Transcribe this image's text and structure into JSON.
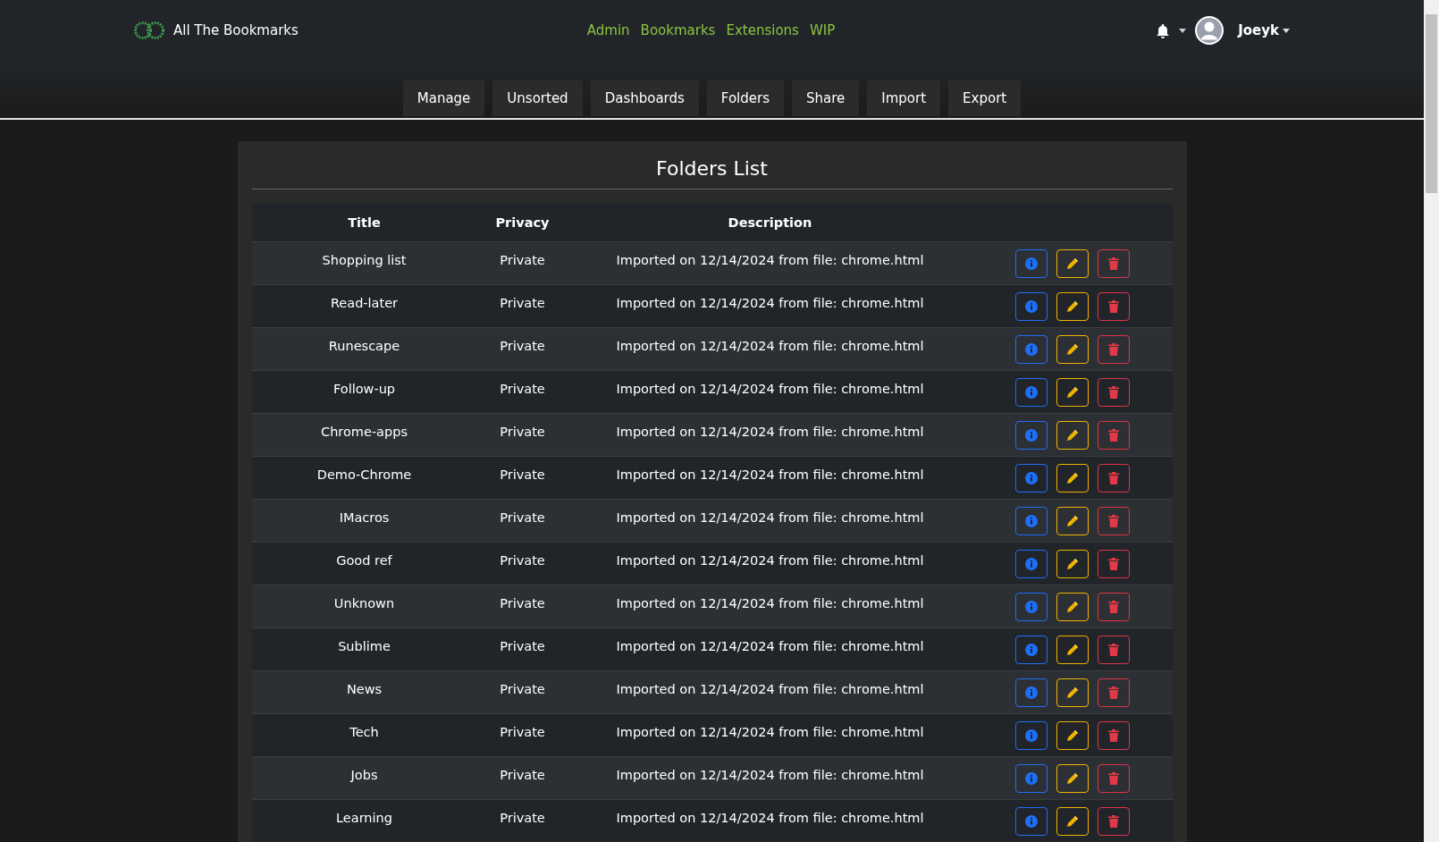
{
  "brand": {
    "name": "All The Bookmarks"
  },
  "nav_links": [
    "Admin",
    "Bookmarks",
    "Extensions",
    "WIP"
  ],
  "user": {
    "name": "Joeyk"
  },
  "tabs": [
    {
      "label": "Manage",
      "selected": false
    },
    {
      "label": "Unsorted",
      "selected": false
    },
    {
      "label": "Dashboards",
      "selected": false
    },
    {
      "label": "Folders",
      "selected": false
    },
    {
      "label": "Share",
      "selected": false
    },
    {
      "label": "Import",
      "selected": false
    },
    {
      "label": "Export",
      "selected": false
    }
  ],
  "panel": {
    "title": "Folders List"
  },
  "table": {
    "columns": [
      "Title",
      "Privacy",
      "Description"
    ],
    "rows": [
      {
        "title": "Shopping list",
        "privacy": "Private",
        "description": "Imported on 12/14/2024 from file: chrome.html"
      },
      {
        "title": "Read-later",
        "privacy": "Private",
        "description": "Imported on 12/14/2024 from file: chrome.html"
      },
      {
        "title": "Runescape",
        "privacy": "Private",
        "description": "Imported on 12/14/2024 from file: chrome.html"
      },
      {
        "title": "Follow-up",
        "privacy": "Private",
        "description": "Imported on 12/14/2024 from file: chrome.html"
      },
      {
        "title": "Chrome-apps",
        "privacy": "Private",
        "description": "Imported on 12/14/2024 from file: chrome.html"
      },
      {
        "title": "Demo-Chrome",
        "privacy": "Private",
        "description": "Imported on 12/14/2024 from file: chrome.html"
      },
      {
        "title": "IMacros",
        "privacy": "Private",
        "description": "Imported on 12/14/2024 from file: chrome.html"
      },
      {
        "title": "Good ref",
        "privacy": "Private",
        "description": "Imported on 12/14/2024 from file: chrome.html"
      },
      {
        "title": "Unknown",
        "privacy": "Private",
        "description": "Imported on 12/14/2024 from file: chrome.html"
      },
      {
        "title": "Sublime",
        "privacy": "Private",
        "description": "Imported on 12/14/2024 from file: chrome.html"
      },
      {
        "title": "News",
        "privacy": "Private",
        "description": "Imported on 12/14/2024 from file: chrome.html"
      },
      {
        "title": "Tech",
        "privacy": "Private",
        "description": "Imported on 12/14/2024 from file: chrome.html"
      },
      {
        "title": "Jobs",
        "privacy": "Private",
        "description": "Imported on 12/14/2024 from file: chrome.html"
      },
      {
        "title": "Learning",
        "privacy": "Private",
        "description": "Imported on 12/14/2024 from file: chrome.html"
      }
    ]
  }
}
